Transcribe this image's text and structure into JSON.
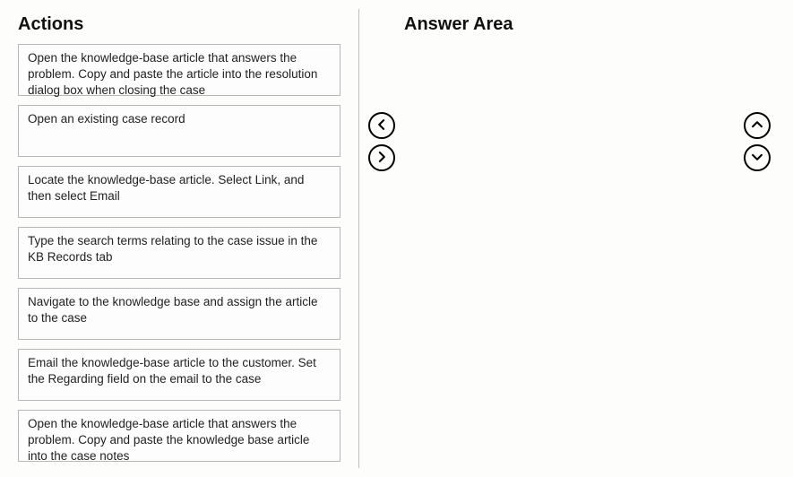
{
  "headings": {
    "actions": "Actions",
    "answer": "Answer Area"
  },
  "actions": {
    "items": [
      {
        "label": "Open the knowledge-base article that answers the problem. Copy and paste the article into the resolution dialog box when closing the case"
      },
      {
        "label": "Open an existing case record"
      },
      {
        "label": "Locate the knowledge-base article. Select Link, and then select Email"
      },
      {
        "label": "Type the search terms relating to the case issue in the KB Records tab"
      },
      {
        "label": "Navigate to the knowledge base and assign the article to the case"
      },
      {
        "label": "Email the knowledge-base article to the customer. Set the Regarding field on the email to the case"
      },
      {
        "label": "Open the knowledge-base article that answers the problem. Copy and paste the knowledge base article into the case notes"
      }
    ]
  },
  "controls": {
    "left": "move-left",
    "right": "move-right",
    "up": "move-up",
    "down": "move-down"
  }
}
